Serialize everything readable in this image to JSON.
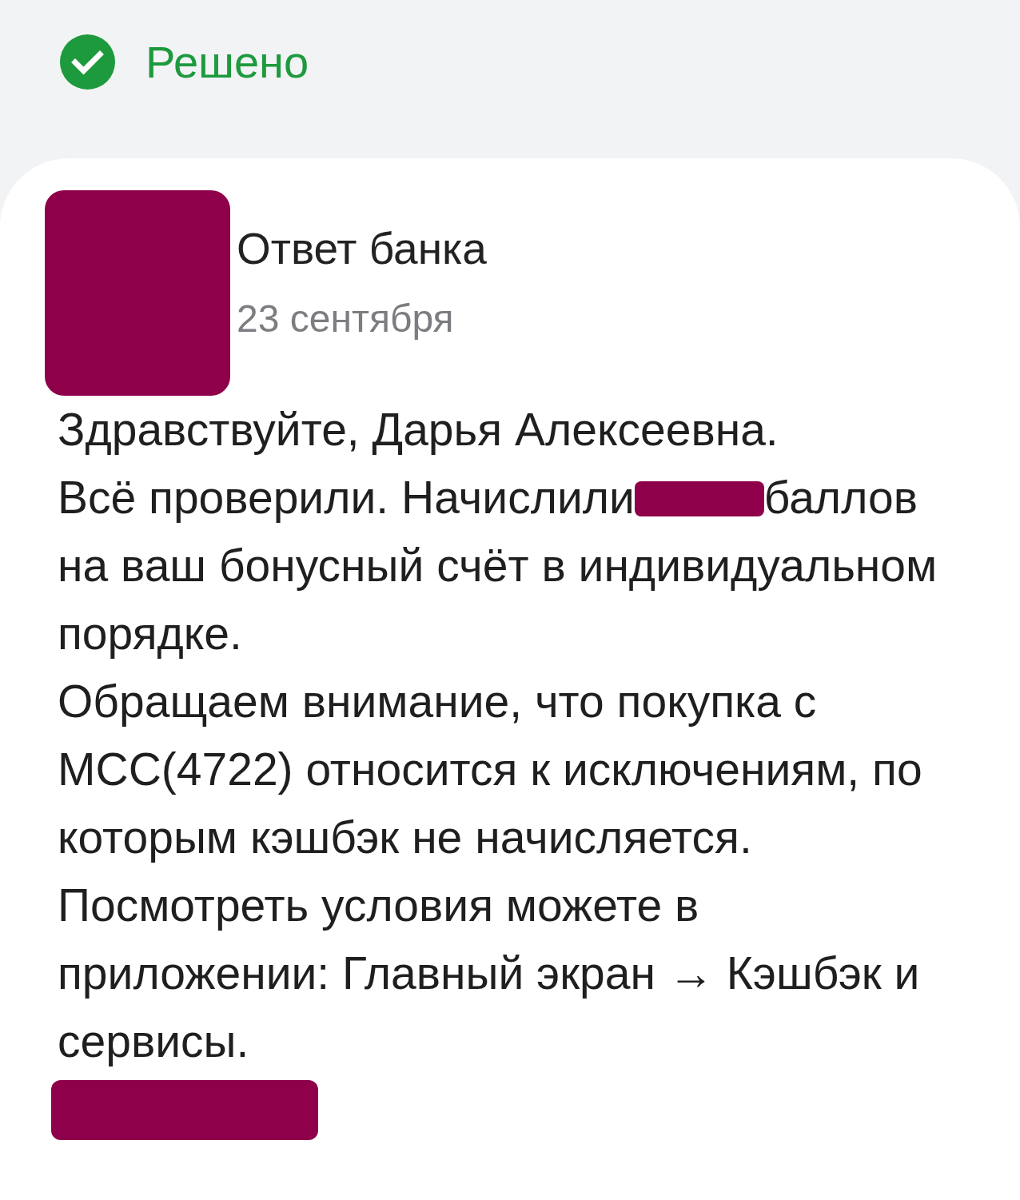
{
  "status": {
    "kind": "resolved",
    "label": "Решено"
  },
  "message": {
    "avatar": {
      "redacted": true
    },
    "author": "Ответ банка",
    "date": "23 сентября",
    "paragraphs": [
      {
        "segments": [
          {
            "kind": "text",
            "text": "Здравствуйте, Дарья Алексеевна."
          }
        ]
      },
      {
        "segments": [
          {
            "kind": "text",
            "text": "Всё проверили. Начислили"
          },
          {
            "kind": "redaction"
          },
          {
            "kind": "text",
            "text": "баллов"
          },
          {
            "kind": "text",
            "text": "на ваш бонусный счёт в индивидуальном порядке."
          }
        ]
      },
      {
        "segments": [
          {
            "kind": "text",
            "text": "Обращаем внимание, что покупка с МСС(4722) относится к исключениям, по которым кэшбэк не начисляется."
          }
        ]
      },
      {
        "segments": [
          {
            "kind": "text",
            "text": "Посмотреть условия можете в приложении: Главный экран → Кэшбэк и сервисы."
          }
        ]
      }
    ],
    "signature": {
      "redacted": true
    }
  }
}
